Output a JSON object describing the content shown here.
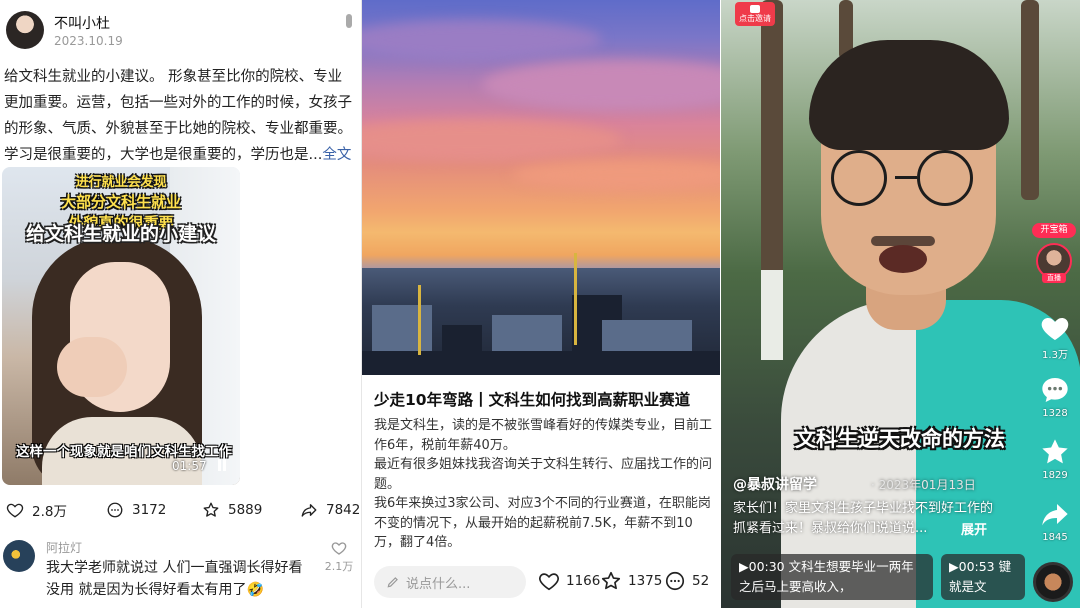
{
  "post1": {
    "username": "不叫小杜",
    "date": "2023.10.19",
    "text": "给文科生就业的小建议。 形象甚至比你的院校、专业更加重要。运营，包括一些对外的工作的时候，女孩子的形象、气质、外貌甚至于比她的院校、专业都重要。学习是很重要的，大学也是很重要的，学历也是...",
    "more": "全文",
    "video": {
      "caption_top": "进行就业会发现",
      "caption_line1": "大部分文科生就业",
      "caption_line2": "外貌真的很重要",
      "caption_title": "给文科生就业的小建议",
      "subtitle": "这样一个现象就是咱们文科生找工作",
      "duration": "01:57"
    },
    "actions": {
      "likes": "2.8万",
      "comments": "3172",
      "favorites": "5889",
      "shares": "7842"
    },
    "comment": {
      "name": "阿拉灯",
      "text": "我大学老师就说过 人们一直强调长得好看没用 就是因为长得好看太有用了🤣",
      "likes": "2.1万"
    }
  },
  "post2": {
    "title": "少走10年弯路丨文科生如何找到高薪职业赛道",
    "body": [
      "我是文科生，读的是不被张雪峰看好的传媒类专业，目前工作6年，税前年薪40万。",
      "最近有很多姐妹找我咨询关于文科生转行、应届找工作的问题。",
      "我6年来换过3家公司、对应3个不同的行业赛道，在职能岗不变的情况下，从最开始的起薪税前7.5K，年薪不到10万，翻了4倍。"
    ],
    "input_placeholder": "说点什么...",
    "likes": "1166",
    "favorites": "1375",
    "comments": "52"
  },
  "post3": {
    "app_badge": "点击邀请",
    "banner": "文科生逆天改命的方法",
    "author": "@暴叔讲留学",
    "date": "· 2023年01月13日",
    "desc": "家长们！家里文科生孩子毕业找不到好工作的抓紧看过来！暴叔给你们说道说...",
    "expand": "展开",
    "live_badge": "开宝箱",
    "live_tag": "直播",
    "likes": "1.3万",
    "comments": "1328",
    "favorites": "1829",
    "shares": "1845",
    "cards": [
      {
        "time": "▶00:30",
        "text": "文科生想要毕业一两年之后马上要高收入，"
      },
      {
        "time": "▶00:53",
        "text": "键就是文"
      }
    ]
  },
  "colors": {
    "link": "#3a62a8",
    "like_red": "#ff2d55",
    "teal": "#2ec3b6"
  }
}
